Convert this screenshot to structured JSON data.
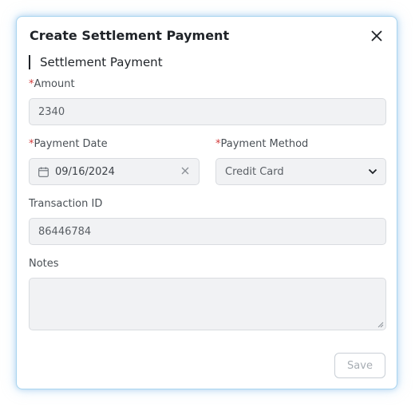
{
  "dialog": {
    "title": "Create Settlement Payment",
    "section_title": "Settlement Payment"
  },
  "form": {
    "amount": {
      "required_mark": "*",
      "label": "Amount",
      "value": "2340"
    },
    "payment_date": {
      "required_mark": "*",
      "label": "Payment Date",
      "value": "09/16/2024"
    },
    "payment_method": {
      "required_mark": "*",
      "label": "Payment Method",
      "value": "Credit Card"
    },
    "transaction_id": {
      "label": "Transaction ID",
      "value": "86446784"
    },
    "notes": {
      "label": "Notes",
      "value": ""
    }
  },
  "actions": {
    "save_label": "Save"
  },
  "icons": {
    "close": "close-icon",
    "calendar": "calendar-icon",
    "clear": "clear-icon",
    "dropdown": "chevron-down-icon"
  },
  "colors": {
    "required": "#d23b3b",
    "dialog_border": "#a9d4f0",
    "field_background": "#f1f2f4",
    "disabled_text": "#a7adb3"
  }
}
